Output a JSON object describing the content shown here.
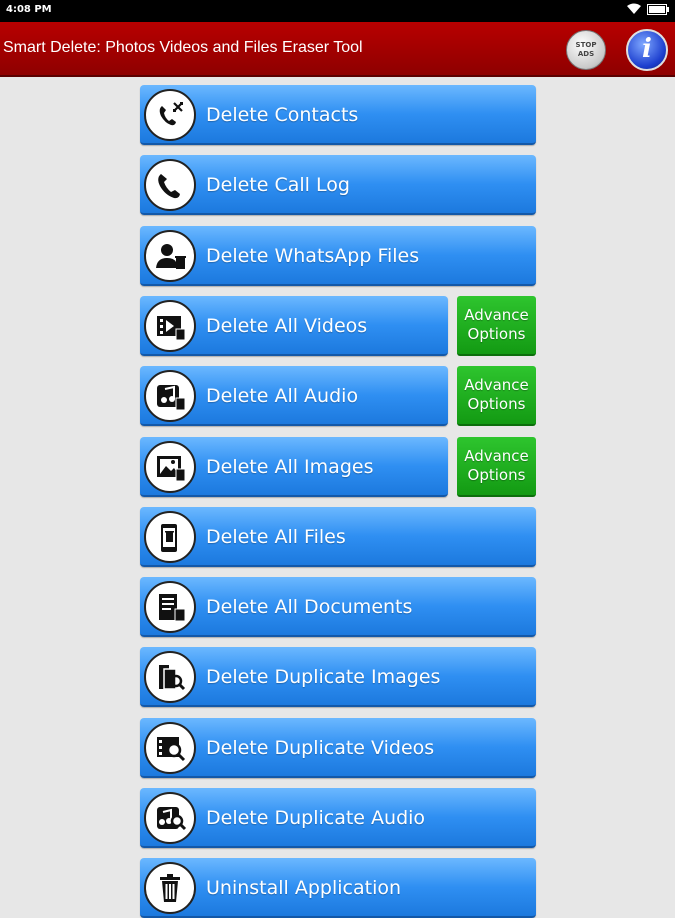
{
  "status_bar": {
    "time": "4:08 PM"
  },
  "app_bar": {
    "title": "Smart Delete: Photos Videos and Files Eraser Tool",
    "stop_ads_label": "STOP ADS",
    "info_label": "i"
  },
  "menu": [
    {
      "label": "Delete Contacts",
      "icon": "contacts-icon"
    },
    {
      "label": "Delete Call Log",
      "icon": "phone-icon"
    },
    {
      "label": "Delete WhatsApp Files",
      "icon": "user-trash-icon"
    },
    {
      "label": "Delete All Videos",
      "icon": "video-trash-icon",
      "advance": "Advance Options"
    },
    {
      "label": "Delete All Audio",
      "icon": "music-trash-icon",
      "advance": "Advance Options"
    },
    {
      "label": "Delete All Images",
      "icon": "image-trash-icon",
      "advance": "Advance Options"
    },
    {
      "label": "Delete All Files",
      "icon": "phone-trash-icon"
    },
    {
      "label": "Delete All Documents",
      "icon": "document-trash-icon"
    },
    {
      "label": "Delete Duplicate Images",
      "icon": "duplicate-image-icon"
    },
    {
      "label": "Delete Duplicate Videos",
      "icon": "duplicate-video-icon"
    },
    {
      "label": "Delete Duplicate Audio",
      "icon": "duplicate-audio-icon"
    },
    {
      "label": "Uninstall Application",
      "icon": "trash-icon"
    }
  ],
  "colors": {
    "app_bar": "#a00000",
    "button_blue": "#2f8ff2",
    "advance_green": "#1aaa1a",
    "background": "#e7e7e7"
  }
}
